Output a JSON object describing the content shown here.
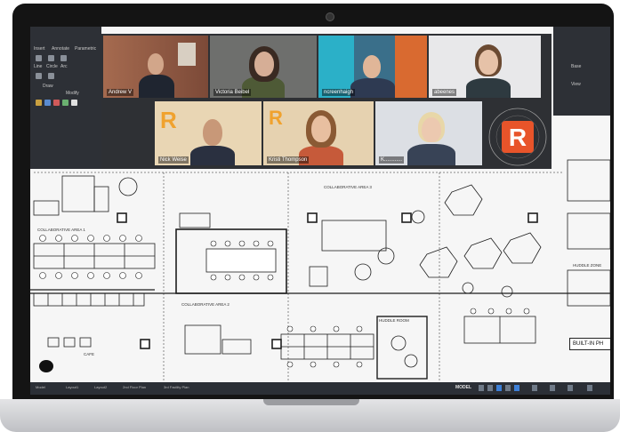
{
  "participants": [
    {
      "name": "Andrew V"
    },
    {
      "name": "Victoria Beibel"
    },
    {
      "name": "ncreenhaigh"
    },
    {
      "name": "abeenes"
    },
    {
      "name": "Nick Weise"
    },
    {
      "name": "Kristi Thompson"
    },
    {
      "name": "K............"
    }
  ],
  "branding": {
    "logo_letter": "R",
    "logo_ring_text": "RIGHTSIZE FACILITY",
    "tile_letter": "R"
  },
  "cad": {
    "ribbon_labels": [
      "Insert",
      "Annotate",
      "Parametric",
      "Line",
      "Circle",
      "Arc",
      "Draw",
      "Modify"
    ],
    "right_ribbon_labels": [
      "Base",
      "View"
    ],
    "area_labels": [
      "COLLABORATIVE AREA 1",
      "COLLABORATIVE AREA 2",
      "COLLABORATIVE AREA 3",
      "CAFE",
      "HUDDLE ROOM",
      "HUDDLE ZONE"
    ],
    "built_in_label": "BUILT-IN PH",
    "layout_tabs": [
      "Model",
      "Layout1",
      "Layout2",
      "2nd Floor Plan",
      "3rd Facility Plan"
    ],
    "model_label": "MODEL"
  },
  "colors": {
    "brand_orange": "#e8542a",
    "zoom_panel": "#2e3034",
    "cad_dark_ui": "#2b2f36"
  }
}
